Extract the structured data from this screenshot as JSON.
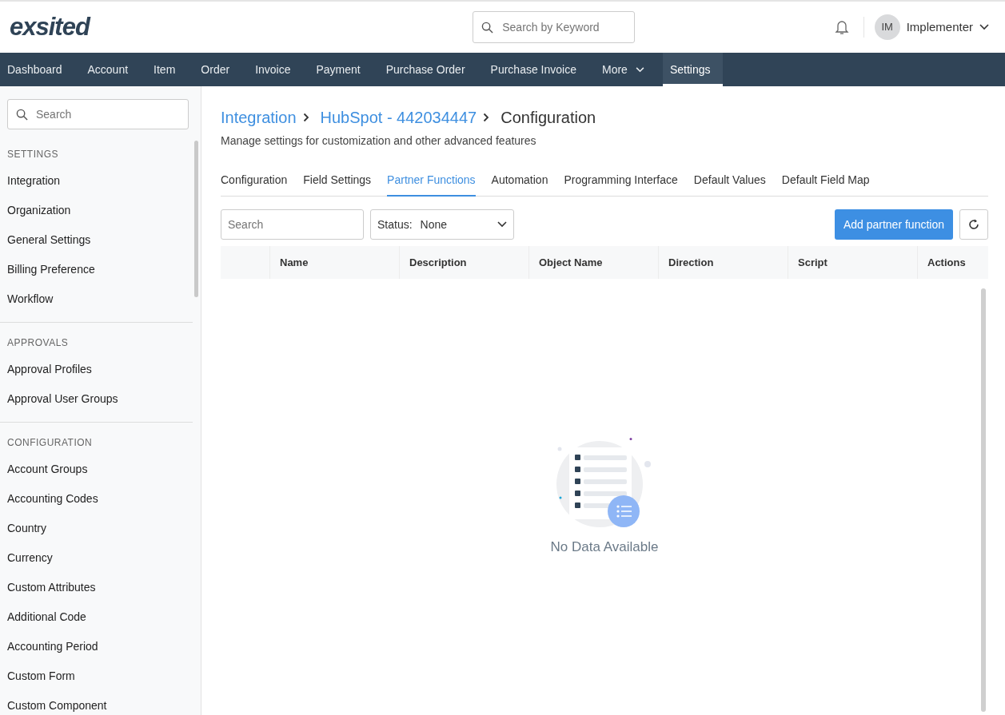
{
  "header": {
    "logo": "exsited",
    "search": {
      "placeholder": "Search by Keyword"
    },
    "user": {
      "initials": "IM",
      "name": "Implementer"
    }
  },
  "nav": [
    {
      "label": "Dashboard",
      "selected": false
    },
    {
      "label": "Account",
      "selected": false
    },
    {
      "label": "Item",
      "selected": false
    },
    {
      "label": "Order",
      "selected": false
    },
    {
      "label": "Invoice",
      "selected": false
    },
    {
      "label": "Payment",
      "selected": false
    },
    {
      "label": "Purchase Order",
      "selected": false
    },
    {
      "label": "Purchase Invoice",
      "selected": false
    },
    {
      "label": "More",
      "selected": false,
      "dropdown": true
    },
    {
      "label": "Settings",
      "selected": true
    }
  ],
  "sidebar": {
    "search": {
      "placeholder": "Search"
    },
    "sections": [
      {
        "title": "SETTINGS",
        "items": [
          "Integration",
          "Organization",
          "General Settings",
          "Billing Preference",
          "Workflow"
        ]
      },
      {
        "title": "APPROVALS",
        "items": [
          "Approval Profiles",
          "Approval User Groups"
        ]
      },
      {
        "title": "CONFIGURATION",
        "items": [
          "Account Groups",
          "Accounting Codes",
          "Country",
          "Currency",
          "Custom Attributes",
          "Additional Code",
          "Accounting Period",
          "Custom Form",
          "Custom Component"
        ]
      }
    ]
  },
  "breadcrumb": [
    "Integration",
    "HubSpot - 442034447",
    "Configuration"
  ],
  "subtitle": "Manage settings for customization and other advanced features",
  "tabs": [
    {
      "label": "Configuration",
      "selected": false
    },
    {
      "label": "Field Settings",
      "selected": false
    },
    {
      "label": "Partner Functions",
      "selected": true
    },
    {
      "label": "Automation",
      "selected": false
    },
    {
      "label": "Programming Interface",
      "selected": false
    },
    {
      "label": "Default Values",
      "selected": false
    },
    {
      "label": "Default Field Map",
      "selected": false
    }
  ],
  "toolbar": {
    "search": {
      "placeholder": "Search"
    },
    "status": {
      "label": "Status:",
      "value": "None"
    },
    "add_button": "Add partner function"
  },
  "table": {
    "columns": [
      "Name",
      "Description",
      "Object Name",
      "Direction",
      "Script",
      "Actions"
    ],
    "empty_text": "No Data Available"
  }
}
